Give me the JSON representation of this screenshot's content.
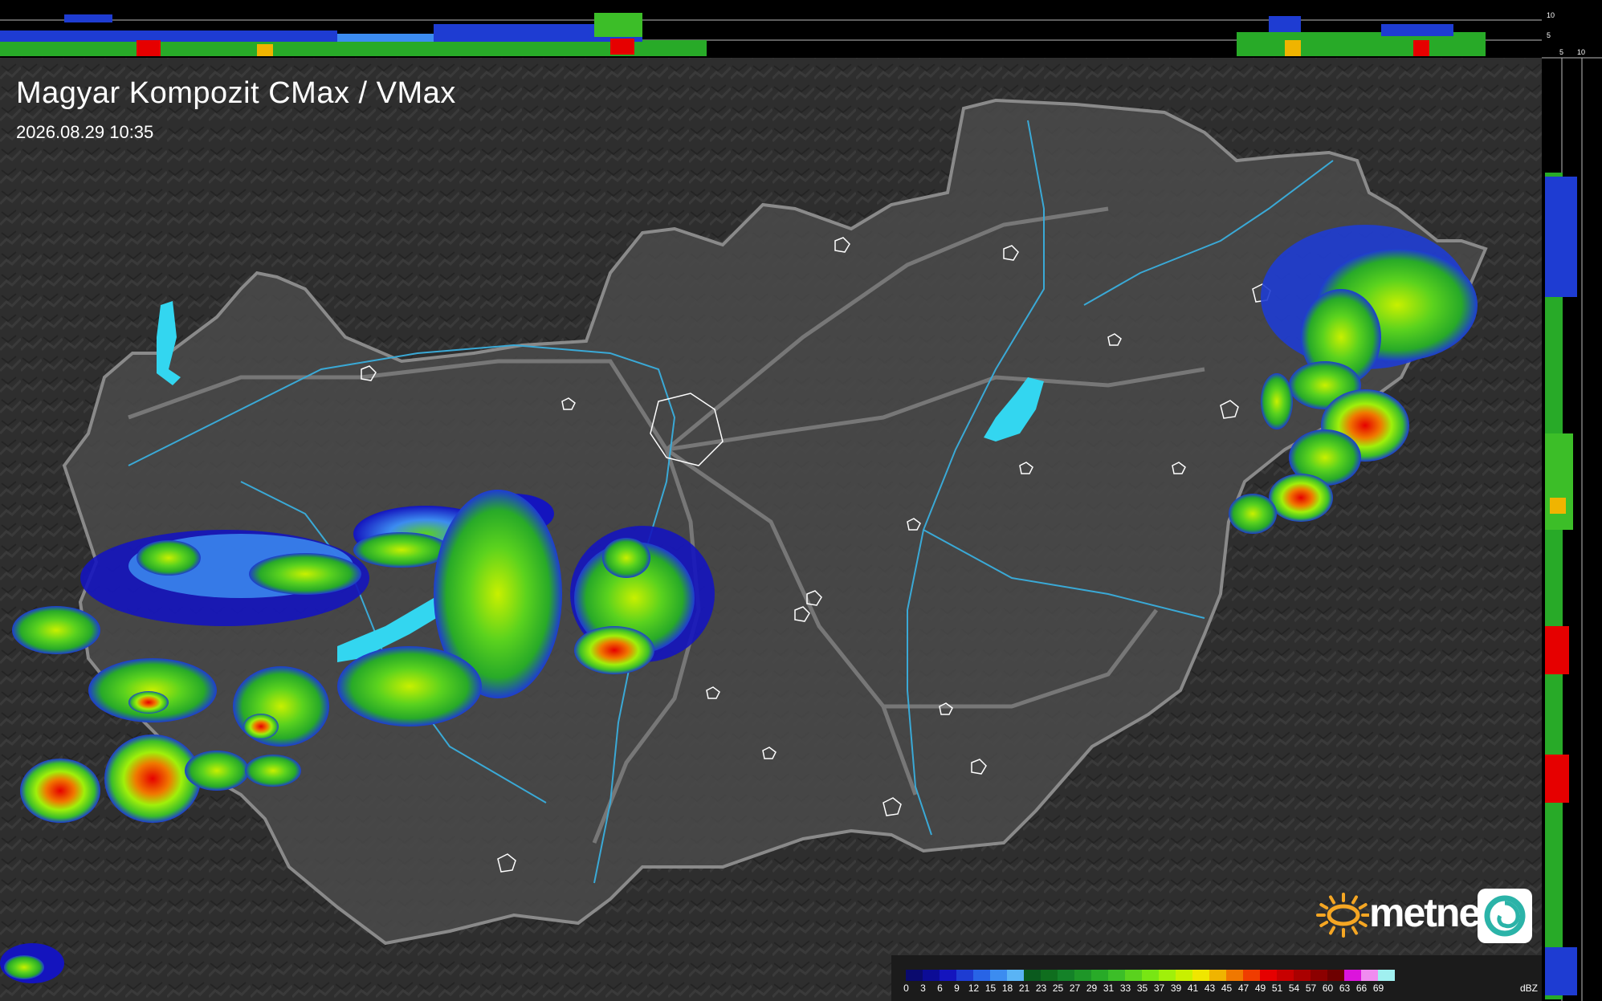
{
  "map": {
    "title": "Magyar Kompozit CMax / VMax",
    "timestamp": "2026.08.29 10:35"
  },
  "profile_scale": {
    "top_ticks": [
      "10",
      "5"
    ],
    "side_ticks": [
      "5",
      "10"
    ]
  },
  "legend": {
    "unit": "dBZ",
    "levels": [
      "0",
      "3",
      "6",
      "9",
      "12",
      "15",
      "18",
      "21",
      "23",
      "25",
      "27",
      "29",
      "31",
      "33",
      "35",
      "37",
      "39",
      "41",
      "43",
      "45",
      "47",
      "49",
      "51",
      "54",
      "57",
      "60",
      "63",
      "66",
      "69"
    ],
    "colors": [
      "#0a0a6e",
      "#0c0c96",
      "#1414be",
      "#1e3cd2",
      "#2864e6",
      "#3c8cf0",
      "#5ab4f5",
      "#0a5a1e",
      "#0f6e1e",
      "#148228",
      "#1e9628",
      "#28aa28",
      "#3cbe28",
      "#5ad21e",
      "#78e614",
      "#a0f00a",
      "#c8f000",
      "#f0e600",
      "#f0b400",
      "#f07800",
      "#f03c00",
      "#e60000",
      "#c80000",
      "#aa0000",
      "#8c0000",
      "#6e0000",
      "#dc14dc",
      "#f08cf0",
      "#a0f0f0"
    ],
    "bg_color": "#1b1b1b"
  },
  "brand": {
    "name": "metnet",
    "sun_color": "#f5a623",
    "badge_color": "#2bb3a8"
  },
  "colors": {
    "terrain_bg": "#2b2b2b",
    "country_fill": "#4a4a4a",
    "border_gray": "#8a8a8a",
    "river_blue": "#3aa9d6",
    "lake_cyan": "#33d6f0",
    "settlement_white": "#ffffff"
  }
}
